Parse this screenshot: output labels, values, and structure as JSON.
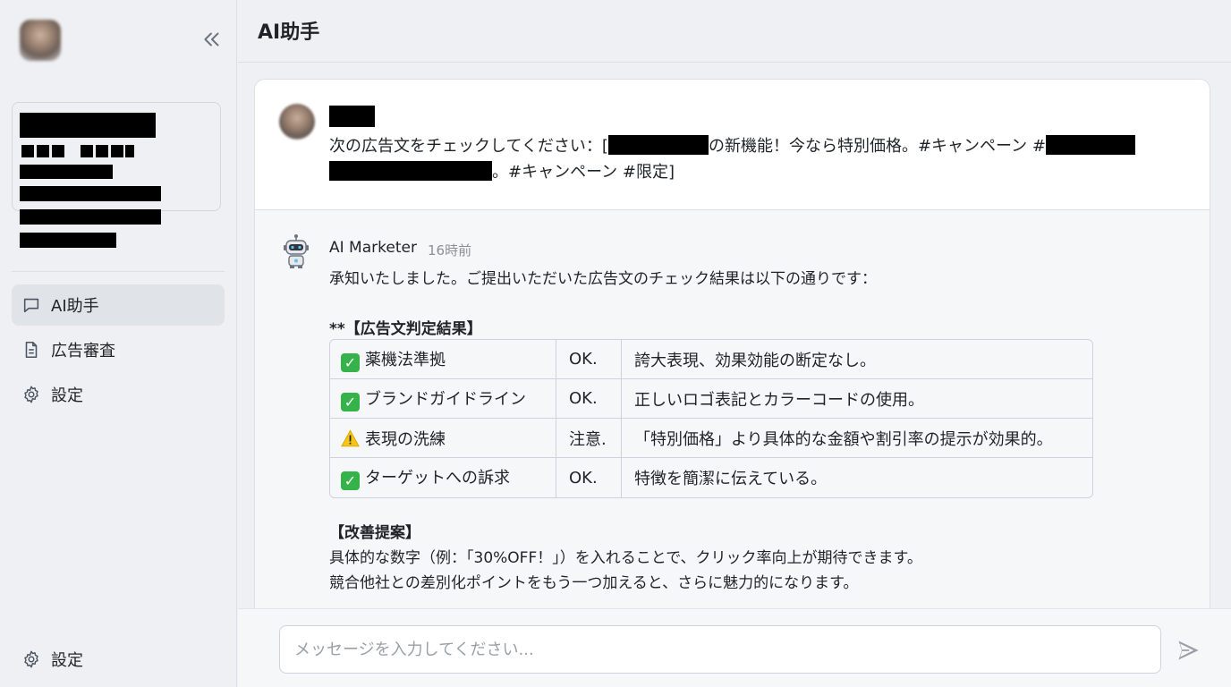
{
  "sidebar": {
    "nav": [
      {
        "label": "AI助手",
        "icon": "chat-bubble-icon",
        "active": true
      },
      {
        "label": "広告審査",
        "icon": "document-icon",
        "active": false
      },
      {
        "label": "設定",
        "icon": "gear-icon",
        "active": false
      }
    ],
    "footer_settings_label": "設定"
  },
  "header": {
    "title": "AI助手"
  },
  "conversation": {
    "user_message": {
      "prefix": "次の広告文をチェックしてください：[",
      "part2": "の新機能！今なら特別価格。#キャンペーン #",
      "part3": "。#キャンペーン #限定]"
    },
    "bot_message": {
      "sender": "AI Marketer",
      "time": "16時前",
      "intro": "承知いたしました。ご提出いただいた広告文のチェック結果は以下の通りです：",
      "result_heading": "**【広告文判定結果】",
      "results": [
        {
          "status": "ok",
          "item": "薬機法準拠",
          "verdict": "OK.",
          "comment": "誇大表現、効果効能の断定なし。"
        },
        {
          "status": "ok",
          "item": "ブランドガイドライン",
          "verdict": "OK.",
          "comment": "正しいロゴ表記とカラーコードの使用。"
        },
        {
          "status": "warn",
          "item": "表現の洗練",
          "verdict": "注意.",
          "comment": "「特別価格」より具体的な金額や割引率の提示が効果的。"
        },
        {
          "status": "ok",
          "item": "ターゲットへの訴求",
          "verdict": "OK.",
          "comment": "特徴を簡潔に伝えている。"
        }
      ],
      "suggestion_heading": "【改善提案】",
      "suggestions": [
        "具体的な数字（例：「30%OFF！」）を入れることで、クリック率向上が期待できます。",
        "競合他社との差別化ポイントをもう一つ加えると、さらに魅力的になります。"
      ]
    }
  },
  "input": {
    "placeholder": "メッセージを入力してください..."
  },
  "colors": {
    "ok_green": "#36b24a",
    "warn_yellow": "#f5c518",
    "accent_gray": "#4b5563"
  }
}
